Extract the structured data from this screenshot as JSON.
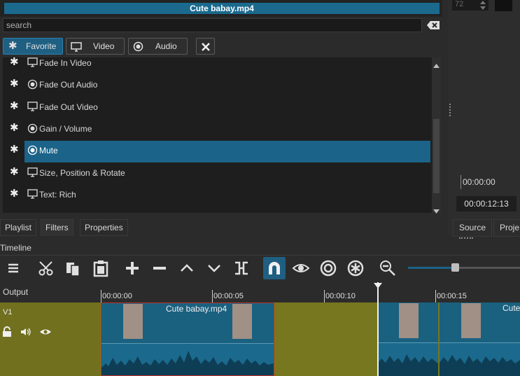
{
  "filters_panel": {
    "title": "Cute babay.mp4",
    "search_placeholder": "search",
    "tabs": [
      {
        "label": "Favorite",
        "active": true
      },
      {
        "label": "Video",
        "active": false
      },
      {
        "label": "Audio",
        "active": false
      }
    ],
    "items": [
      {
        "label": "Fade In Video",
        "icon": "monitor-icon"
      },
      {
        "label": "Fade Out Audio",
        "icon": "speaker-icon"
      },
      {
        "label": "Fade Out Video",
        "icon": "monitor-icon"
      },
      {
        "label": "Gain / Volume",
        "icon": "speaker-icon"
      },
      {
        "label": "Mute",
        "icon": "speaker-icon",
        "selected": true
      },
      {
        "label": "Size, Position & Rotate",
        "icon": "monitor-icon"
      },
      {
        "label": "Text: Rich",
        "icon": "monitor-icon"
      }
    ]
  },
  "bottom_tabs": [
    "Playlist",
    "Filters",
    "Properties"
  ],
  "player": {
    "spin_value": "72",
    "timecode_position": "00:00:00",
    "timecode_duration": "00:00:12:13",
    "tabs": [
      "Source",
      "Proje"
    ]
  },
  "timeline": {
    "label": "Timeline",
    "output_label": "Output",
    "track_label": "V1",
    "ruler": [
      "00:00:00",
      "00:00:05",
      "00:00:10",
      "00:00:15"
    ],
    "clips": [
      {
        "label": "Cute babay.mp4"
      },
      {
        "label": "Cute"
      }
    ]
  },
  "colors": {
    "accent": "#1b6388",
    "track": "#77771f",
    "selected_clip_border": "#c0302a"
  }
}
